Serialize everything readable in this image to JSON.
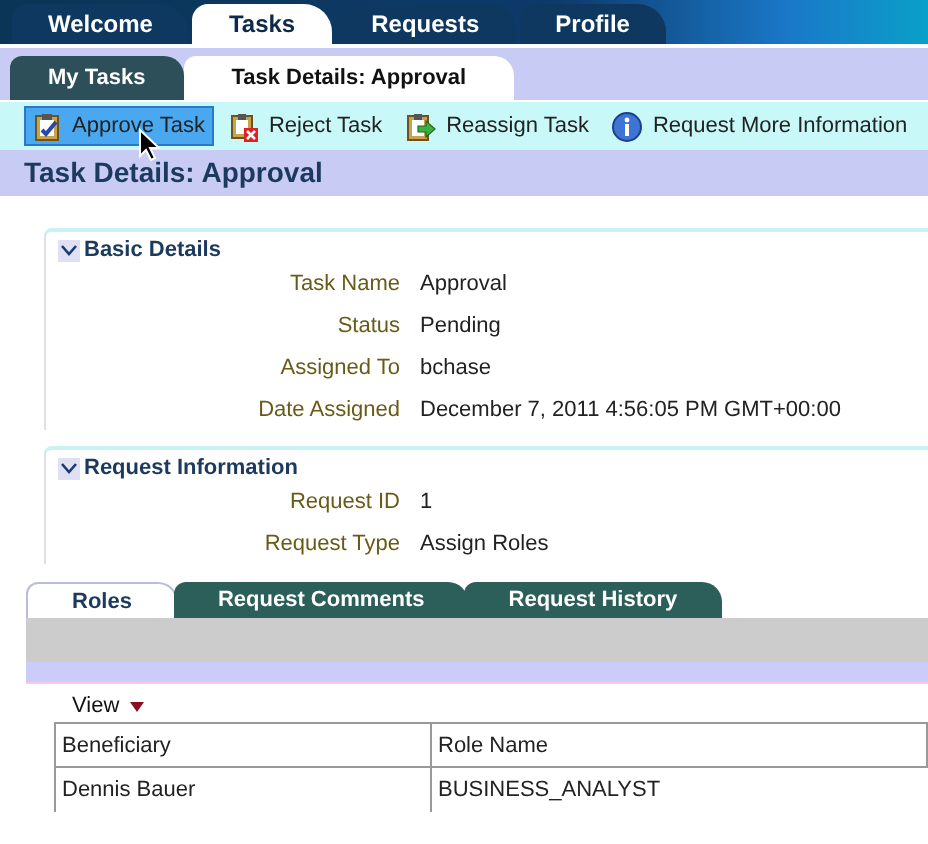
{
  "main_tabs": [
    {
      "label": "Welcome",
      "selected": false
    },
    {
      "label": "Tasks",
      "selected": true
    },
    {
      "label": "Requests",
      "selected": false
    },
    {
      "label": "Profile",
      "selected": false
    }
  ],
  "sub_tabs": [
    {
      "label": "My Tasks",
      "selected": false
    },
    {
      "label": "Task Details: Approval",
      "selected": true
    }
  ],
  "toolbar": [
    {
      "label": "Approve Task",
      "kind": "approve",
      "selected": true
    },
    {
      "label": "Reject Task",
      "kind": "reject",
      "selected": false
    },
    {
      "label": "Reassign Task",
      "kind": "reassign",
      "selected": false
    },
    {
      "label": "Request More Information",
      "kind": "info",
      "selected": false
    }
  ],
  "page_title": "Task Details: Approval",
  "sections": [
    {
      "title": "Basic Details",
      "expanded": true,
      "fields": [
        {
          "label": "Task Name",
          "value": "Approval"
        },
        {
          "label": "Status",
          "value": "Pending"
        },
        {
          "label": "Assigned To",
          "value": "bchase"
        },
        {
          "label": "Date Assigned",
          "value": "December 7, 2011 4:56:05 PM GMT+00:00"
        }
      ]
    },
    {
      "title": "Request Information",
      "expanded": true,
      "fields": [
        {
          "label": "Request ID",
          "value": "1"
        },
        {
          "label": "Request Type",
          "value": "Assign Roles"
        }
      ]
    }
  ],
  "detail_tabs": [
    {
      "label": "Roles",
      "selected": true
    },
    {
      "label": "Request Comments",
      "selected": false
    },
    {
      "label": "Request History",
      "selected": false
    }
  ],
  "view_menu": "View",
  "table": {
    "columns": [
      "Beneficiary",
      "Role Name"
    ],
    "rows": [
      [
        "Dennis Bauer",
        "BUSINESS_ANALYST"
      ]
    ]
  }
}
